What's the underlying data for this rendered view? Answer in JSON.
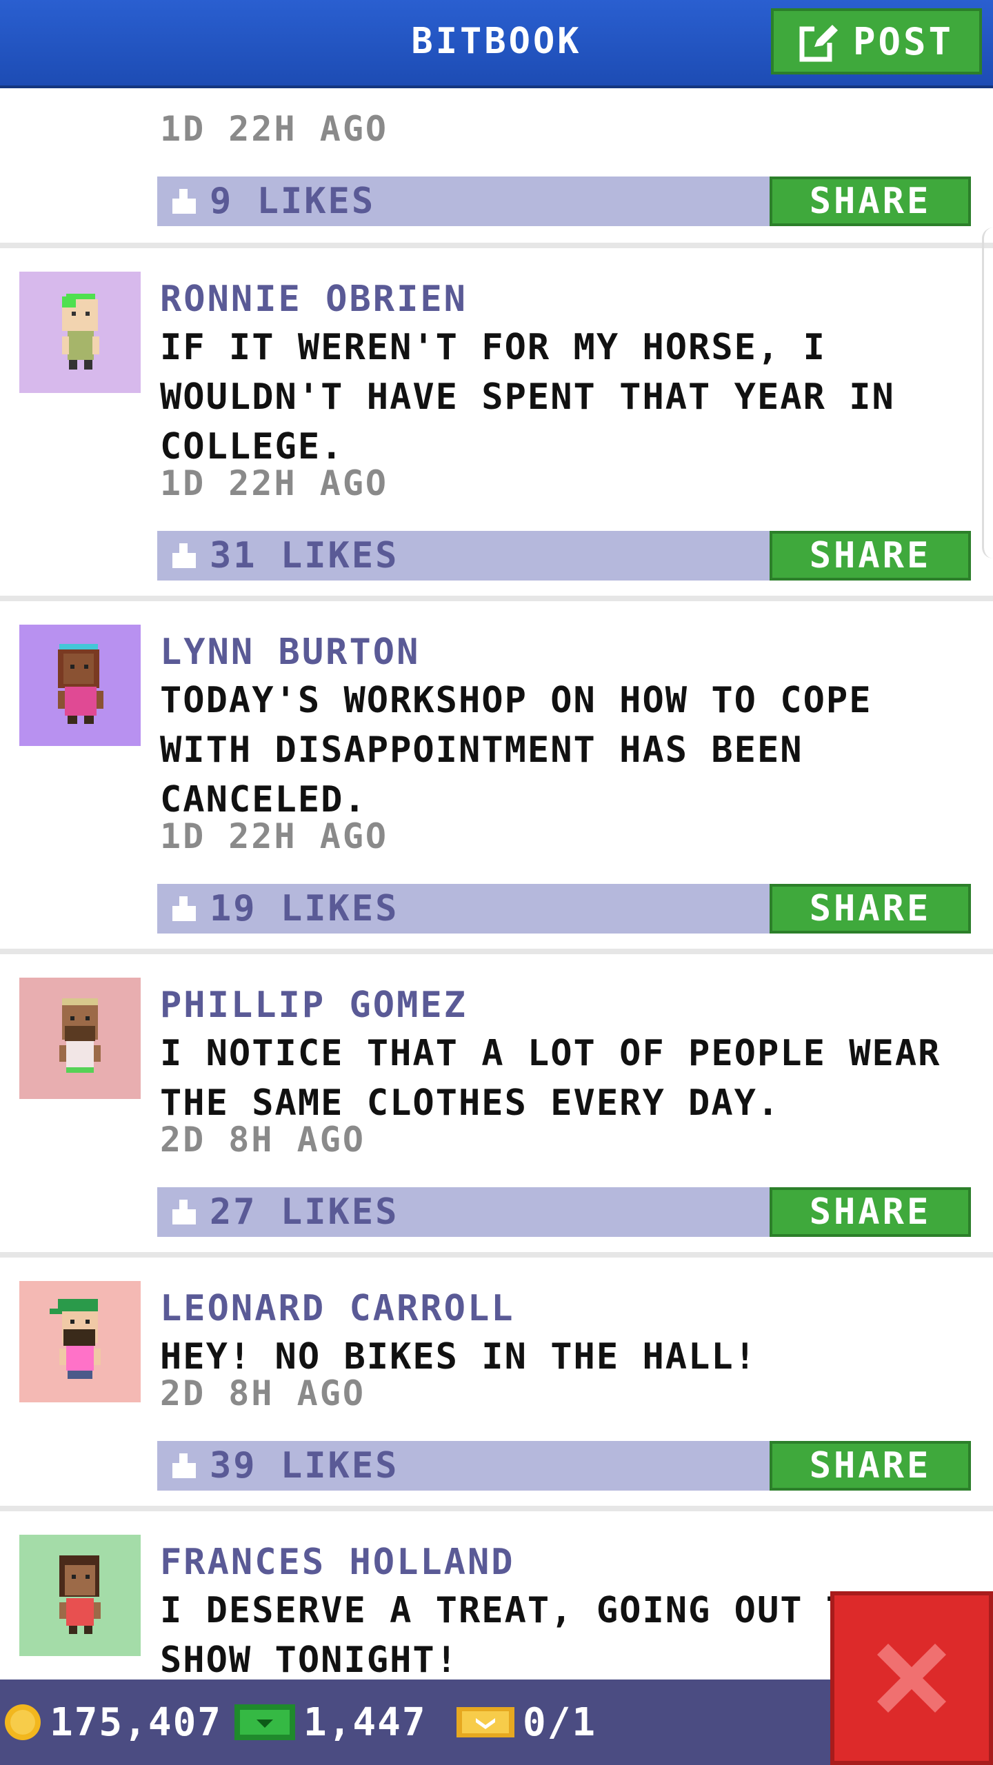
{
  "header": {
    "title": "BITBOOK",
    "post_label": "POST"
  },
  "top_post": {
    "timestamp": "1D 22H AGO",
    "likes": "9 LIKES",
    "share": "SHARE"
  },
  "posts": [
    {
      "author": "RONNIE OBRIEN",
      "message": "IF IT WEREN'T FOR MY HORSE, I WOULDN'T HAVE SPENT THAT YEAR IN COLLEGE.",
      "timestamp": "1D 22H AGO",
      "likes": "31 LIKES",
      "share": "SHARE",
      "avatar_bg": "#d7b9ec"
    },
    {
      "author": "LYNN BURTON",
      "message": "TODAY'S WORKSHOP ON HOW TO COPE WITH DISAPPOINTMENT HAS BEEN CANCELED.",
      "timestamp": "1D 22H AGO",
      "likes": "19 LIKES",
      "share": "SHARE",
      "avatar_bg": "#b891f0"
    },
    {
      "author": "PHILLIP GOMEZ",
      "message": "I NOTICE THAT A LOT OF PEOPLE WEAR THE SAME CLOTHES EVERY DAY.",
      "timestamp": "2D 8H AGO",
      "likes": "27 LIKES",
      "share": "SHARE",
      "avatar_bg": "#e8aeb0"
    },
    {
      "author": "LEONARD CARROLL",
      "message": "HEY! NO BIKES IN THE HALL!",
      "timestamp": "2D 8H AGO",
      "likes": "39 LIKES",
      "share": "SHARE",
      "avatar_bg": "#f4b9b4"
    },
    {
      "author": "FRANCES HOLLAND",
      "message": "I DESERVE A TREAT, GOING OUT TO A SHOW TONIGHT!",
      "avatar_bg": "#a4dca8"
    }
  ],
  "status_bar": {
    "coins": "175,407",
    "bux": "1,447",
    "tickets": "0/1"
  },
  "colors": {
    "header": "#1d4cb4",
    "accent_green": "#3fa93c",
    "like_bar": "#b5b8dc",
    "bottom_bar": "#4b4c82",
    "close": "#dd2a2a"
  }
}
